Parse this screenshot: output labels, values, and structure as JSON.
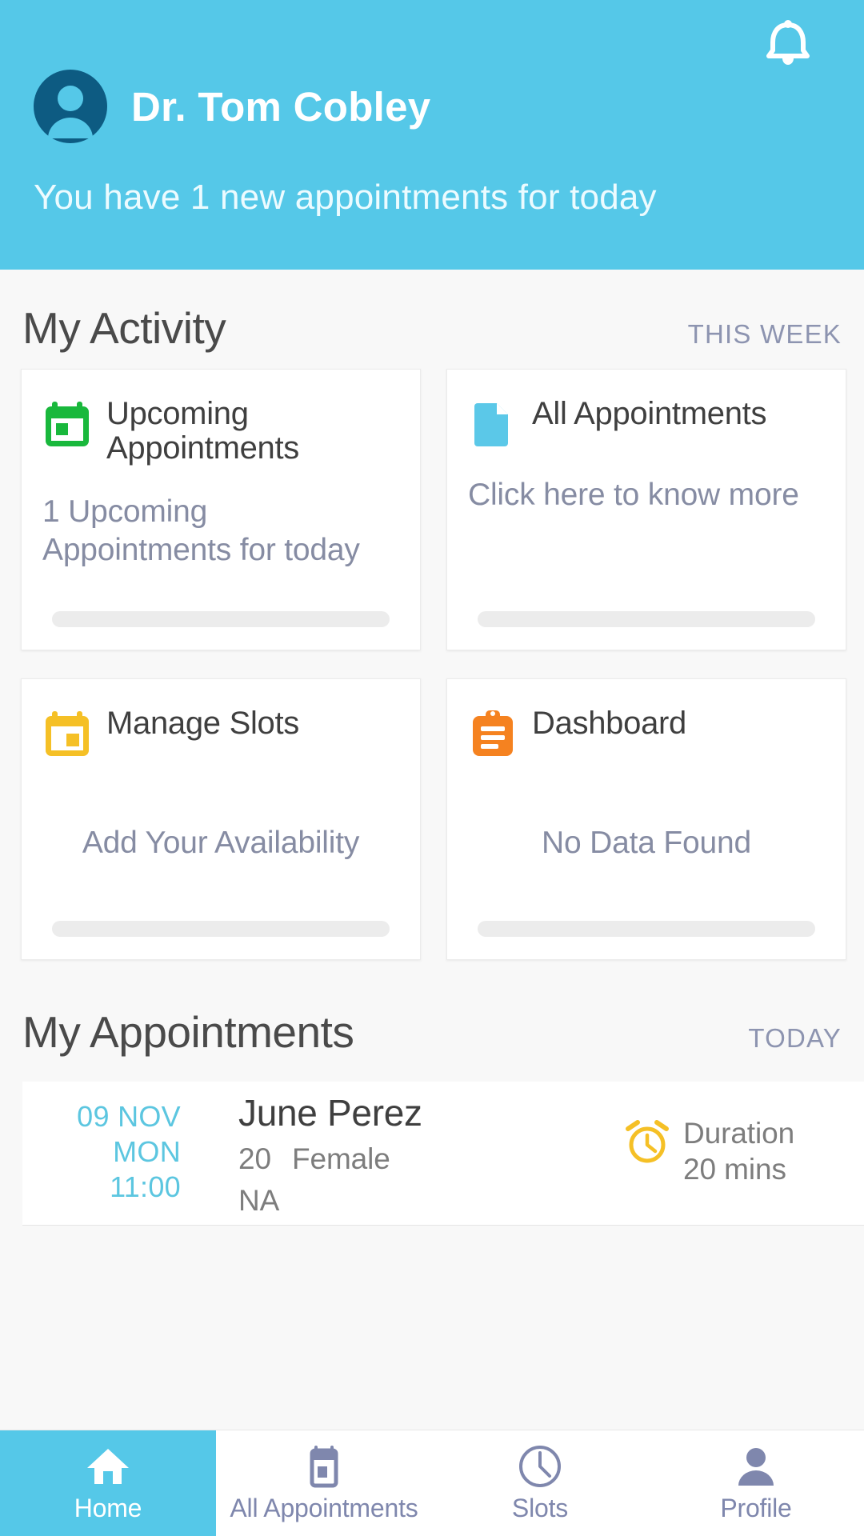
{
  "colors": {
    "brand_blue": "#55c8e8",
    "avatar_navy": "#0d5b82",
    "muted_slate": "#8d94b0",
    "icon_green": "#19b83c",
    "icon_blue": "#5bc8e8",
    "icon_yellow": "#f5c026",
    "icon_orange": "#f58220",
    "text_dark": "#3f3f3f",
    "text_gray": "#7d7d7d",
    "bar_gray": "#ececec",
    "page_bg": "#f8f8f8"
  },
  "header": {
    "avatar_icon": "user-avatar-icon",
    "doctor_name": "Dr. Tom Cobley",
    "notification_icon": "bell-icon",
    "subtitle": "You have 1 new appointments for today"
  },
  "activity": {
    "title": "My Activity",
    "action": "THIS WEEK",
    "cards": [
      {
        "icon": "calendar-green-icon",
        "title": "Upcoming Appointments",
        "body": "1 Upcoming Appointments for today",
        "layout": "wrap"
      },
      {
        "icon": "document-blue-icon",
        "title": "All Appointments",
        "body": "Click here to know more",
        "layout": "wrap"
      },
      {
        "icon": "calendar-yellow-icon",
        "title": "Manage Slots",
        "body": "Add Your Availability",
        "layout": "center"
      },
      {
        "icon": "clipboard-orange-icon",
        "title": "Dashboard",
        "body": "No Data Found",
        "layout": "center"
      }
    ]
  },
  "appointments": {
    "title": "My Appointments",
    "action": "TODAY",
    "items": [
      {
        "date": "09 NOV",
        "day": "MON",
        "time": "11:00",
        "patient_name": "June Perez",
        "age": "20",
        "gender": "Female",
        "notes": "NA",
        "duration_icon": "alarm-clock-icon",
        "duration_label": "Duration",
        "duration_value": "20 mins"
      }
    ]
  },
  "bottom_nav": {
    "items": [
      {
        "label": "Home",
        "icon": "home-icon",
        "active": true
      },
      {
        "label": "All Appointments",
        "icon": "calendar-icon",
        "active": false
      },
      {
        "label": "Slots",
        "icon": "clock-icon",
        "active": false
      },
      {
        "label": "Profile",
        "icon": "person-icon",
        "active": false
      }
    ]
  }
}
